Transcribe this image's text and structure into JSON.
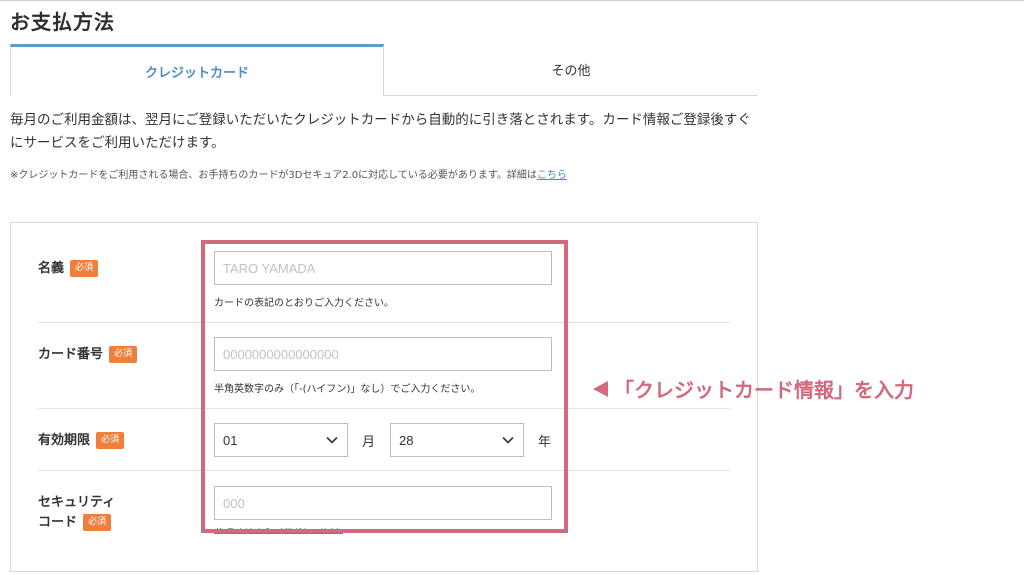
{
  "page": {
    "title": "お支払方法"
  },
  "tabs": [
    {
      "label": "クレジットカード",
      "active": true
    },
    {
      "label": "その他",
      "active": false
    }
  ],
  "description": "毎月のご利用金額は、翌月にご登録いただいたクレジットカードから自動的に引き落とされます。カード情報ご登録後すぐにサービスをご利用いただけます。",
  "note": {
    "text": "※クレジットカードをご利用される場合、お手持ちのカードが3Dセキュア2.0に対応している必要があります。詳細は",
    "link": "こちら"
  },
  "form": {
    "required_badge": "必須",
    "name": {
      "label": "名義",
      "placeholder": "TARO YAMADA",
      "hint": "カードの表記のとおりご入力ください。"
    },
    "card_number": {
      "label": "カード番号",
      "placeholder": "0000000000000000",
      "hint": "半角英数字のみ（「-(ハイフン)」なし）でご入力ください。"
    },
    "expiry": {
      "label": "有効期限",
      "month_value": "01",
      "month_unit": "月",
      "year_value": "28",
      "year_unit": "年"
    },
    "security_code": {
      "label_line1": "セキュリティ",
      "label_line2": "コード",
      "placeholder": "000",
      "help_link": "セキュリティコードについて"
    }
  },
  "annotation": {
    "callout": "「クレジットカード情報」を入力",
    "color": "#d16a7c"
  },
  "colors": {
    "accent_blue": "#4a8fbf",
    "required_badge": "#f07f3c",
    "annotation_pink": "#d16a7c"
  }
}
